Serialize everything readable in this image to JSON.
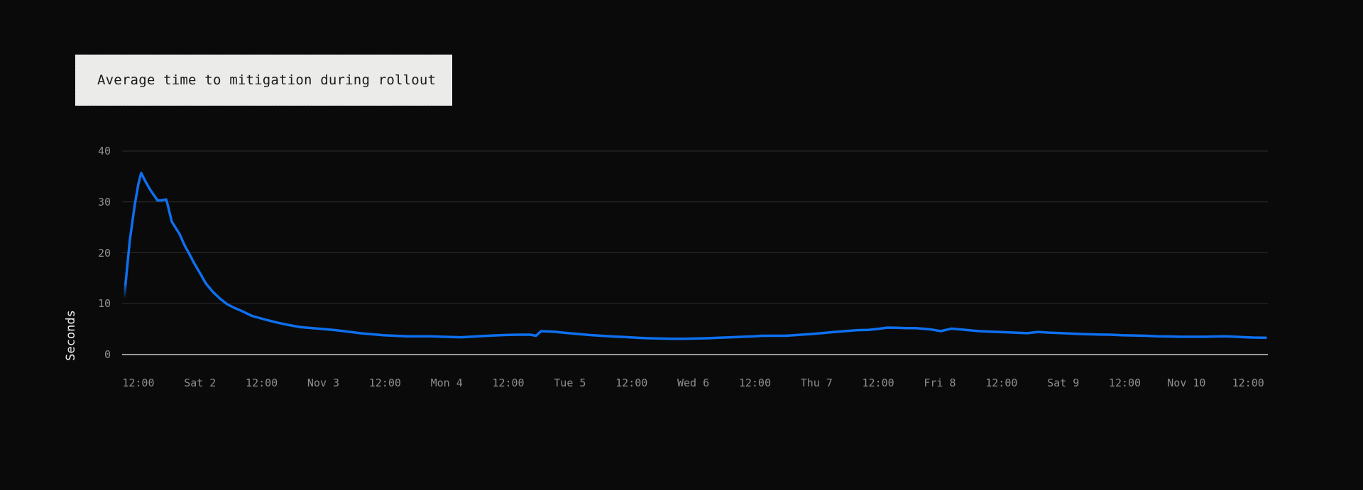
{
  "title": {
    "text": "Average time to mitigation during rollout"
  },
  "y_axis": {
    "title": "Seconds"
  },
  "colors": {
    "background": "#0a0a0a",
    "card_background": "#ebebe9",
    "card_text": "#1a1a1a",
    "grid": "#2e2e2e",
    "axis_line": "#c9c9c9",
    "tick_text": "#8f8f8f",
    "y_axis_title_text": "#ededed",
    "series_line": "#0e70f0"
  },
  "chart_data": {
    "type": "line",
    "title": "Average time to mitigation during rollout",
    "xlabel": "",
    "ylabel": "Seconds",
    "ylim": [
      0,
      40
    ],
    "x_unit": "days_since_Nov_1_00:00",
    "x_domain_days": [
      0.368,
      9.66
    ],
    "grid": "horizontal-only",
    "legend": "none",
    "y_ticks": [
      {
        "value": 40,
        "label": "40"
      },
      {
        "value": 30,
        "label": "30"
      },
      {
        "value": 20,
        "label": "20"
      },
      {
        "value": 10,
        "label": "10"
      },
      {
        "value": 0,
        "label": "0"
      }
    ],
    "x_ticks": [
      {
        "day": 0.5,
        "label": "12:00"
      },
      {
        "day": 1.0,
        "label": "Sat 2"
      },
      {
        "day": 1.5,
        "label": "12:00"
      },
      {
        "day": 2.0,
        "label": "Nov 3"
      },
      {
        "day": 2.5,
        "label": "12:00"
      },
      {
        "day": 3.0,
        "label": "Mon 4"
      },
      {
        "day": 3.5,
        "label": "12:00"
      },
      {
        "day": 4.0,
        "label": "Tue 5"
      },
      {
        "day": 4.5,
        "label": "12:00"
      },
      {
        "day": 5.0,
        "label": "Wed 6"
      },
      {
        "day": 5.5,
        "label": "12:00"
      },
      {
        "day": 6.0,
        "label": "Thu 7"
      },
      {
        "day": 6.5,
        "label": "12:00"
      },
      {
        "day": 7.0,
        "label": "Fri 8"
      },
      {
        "day": 7.5,
        "label": "12:00"
      },
      {
        "day": 8.0,
        "label": "Sat 9"
      },
      {
        "day": 8.5,
        "label": "12:00"
      },
      {
        "day": 9.0,
        "label": "Nov 10"
      },
      {
        "day": 9.5,
        "label": "12:00"
      }
    ],
    "series": [
      {
        "name": "Average time to mitigation",
        "unit": "seconds",
        "color": "#0e70f0",
        "lead_in_fade": true,
        "points": [
          [
            0.3895,
            11.0
          ],
          [
            0.393,
            12.8
          ],
          [
            0.396,
            14.0
          ],
          [
            0.431,
            22.5
          ],
          [
            0.471,
            29.5
          ],
          [
            0.5,
            33.5
          ],
          [
            0.523,
            35.7
          ],
          [
            0.558,
            34.0
          ],
          [
            0.598,
            32.3
          ],
          [
            0.655,
            30.3
          ],
          [
            0.69,
            30.3
          ],
          [
            0.725,
            30.5
          ],
          [
            0.736,
            29.6
          ],
          [
            0.771,
            26.1
          ],
          [
            0.834,
            23.7
          ],
          [
            0.874,
            21.5
          ],
          [
            0.915,
            19.7
          ],
          [
            0.949,
            18.1
          ],
          [
            1.007,
            15.7
          ],
          [
            1.047,
            14.0
          ],
          [
            1.105,
            12.3
          ],
          [
            1.162,
            11.0
          ],
          [
            1.22,
            9.9
          ],
          [
            1.277,
            9.2
          ],
          [
            1.335,
            8.6
          ],
          [
            1.421,
            7.6
          ],
          [
            1.525,
            6.9
          ],
          [
            1.623,
            6.3
          ],
          [
            1.721,
            5.8
          ],
          [
            1.813,
            5.4
          ],
          [
            1.911,
            5.2
          ],
          [
            2.009,
            5.0
          ],
          [
            2.101,
            4.8
          ],
          [
            2.199,
            4.5
          ],
          [
            2.297,
            4.2
          ],
          [
            2.389,
            4.0
          ],
          [
            2.487,
            3.8
          ],
          [
            2.585,
            3.7
          ],
          [
            2.677,
            3.6
          ],
          [
            2.775,
            3.6
          ],
          [
            2.872,
            3.6
          ],
          [
            2.965,
            3.5
          ],
          [
            3.12,
            3.4
          ],
          [
            3.252,
            3.6
          ],
          [
            3.379,
            3.75
          ],
          [
            3.483,
            3.85
          ],
          [
            3.581,
            3.9
          ],
          [
            3.679,
            3.9
          ],
          [
            3.725,
            3.7
          ],
          [
            3.765,
            4.6
          ],
          [
            3.869,
            4.5
          ],
          [
            3.966,
            4.25
          ],
          [
            4.058,
            4.05
          ],
          [
            4.156,
            3.85
          ],
          [
            4.254,
            3.7
          ],
          [
            4.347,
            3.55
          ],
          [
            4.444,
            3.45
          ],
          [
            4.542,
            3.3
          ],
          [
            4.634,
            3.2
          ],
          [
            4.732,
            3.15
          ],
          [
            4.83,
            3.1
          ],
          [
            4.922,
            3.1
          ],
          [
            5.02,
            3.15
          ],
          [
            5.118,
            3.2
          ],
          [
            5.21,
            3.3
          ],
          [
            5.308,
            3.4
          ],
          [
            5.406,
            3.5
          ],
          [
            5.498,
            3.6
          ],
          [
            5.556,
            3.7
          ],
          [
            5.654,
            3.7
          ],
          [
            5.751,
            3.7
          ],
          [
            5.844,
            3.85
          ],
          [
            5.941,
            4.0
          ],
          [
            6.039,
            4.2
          ],
          [
            6.131,
            4.4
          ],
          [
            6.229,
            4.6
          ],
          [
            6.327,
            4.8
          ],
          [
            6.419,
            4.85
          ],
          [
            6.517,
            5.1
          ],
          [
            6.575,
            5.3
          ],
          [
            6.65,
            5.25
          ],
          [
            6.73,
            5.2
          ],
          [
            6.805,
            5.2
          ],
          [
            6.88,
            5.05
          ],
          [
            6.937,
            4.9
          ],
          [
            7.007,
            4.6
          ],
          [
            7.093,
            5.1
          ],
          [
            7.179,
            4.9
          ],
          [
            7.248,
            4.75
          ],
          [
            7.323,
            4.6
          ],
          [
            7.421,
            4.5
          ],
          [
            7.513,
            4.4
          ],
          [
            7.611,
            4.3
          ],
          [
            7.709,
            4.2
          ],
          [
            7.795,
            4.45
          ],
          [
            7.887,
            4.3
          ],
          [
            7.997,
            4.2
          ],
          [
            8.089,
            4.1
          ],
          [
            8.187,
            4.0
          ],
          [
            8.285,
            3.95
          ],
          [
            8.388,
            3.9
          ],
          [
            8.475,
            3.8
          ],
          [
            8.572,
            3.75
          ],
          [
            8.665,
            3.7
          ],
          [
            8.762,
            3.6
          ],
          [
            8.86,
            3.55
          ],
          [
            8.952,
            3.5
          ],
          [
            9.05,
            3.5
          ],
          [
            9.148,
            3.5
          ],
          [
            9.24,
            3.55
          ],
          [
            9.309,
            3.6
          ],
          [
            9.396,
            3.5
          ],
          [
            9.482,
            3.4
          ],
          [
            9.539,
            3.35
          ],
          [
            9.643,
            3.3
          ]
        ]
      }
    ]
  }
}
